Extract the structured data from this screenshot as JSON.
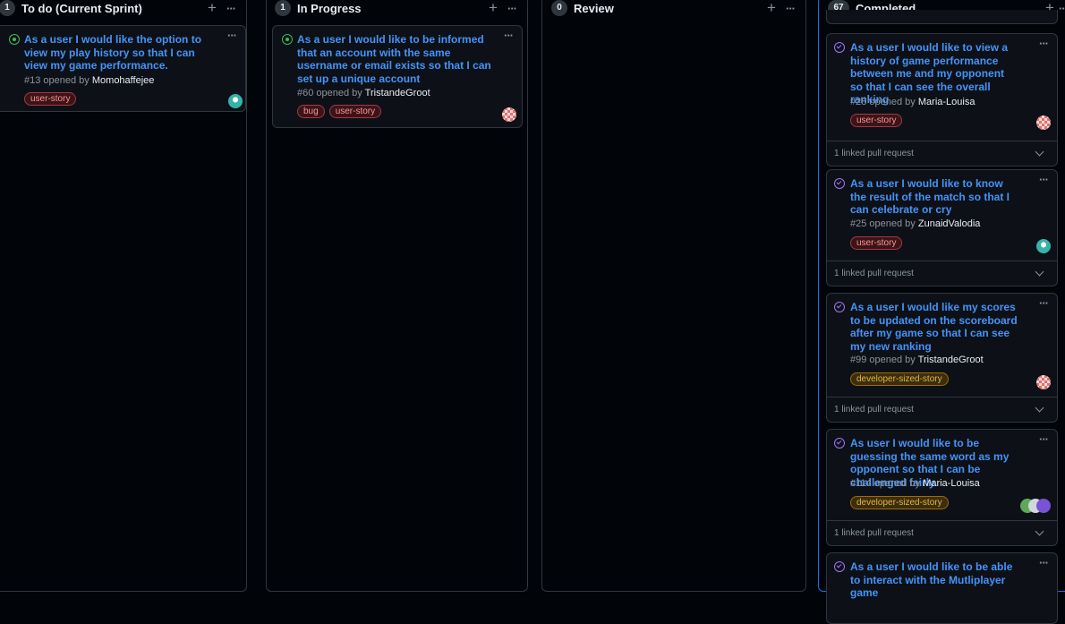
{
  "columns": {
    "todo": {
      "count": "1",
      "title": "To do (Current Sprint)"
    },
    "in_progress": {
      "count": "1",
      "title": "In Progress"
    },
    "review": {
      "count": "0",
      "title": "Review"
    },
    "completed": {
      "count": "67",
      "title": "Completed"
    }
  },
  "header_icons": {
    "add": "plus-icon",
    "menu": "kebab-horizontal-icon"
  },
  "cards": {
    "todo_0": {
      "title": "As a user I would like the option to view my play history so that I can view my game performance.",
      "number": "#13",
      "opened_by": "opened by",
      "author": "Momohaffejee",
      "labels": [
        "user-story"
      ],
      "status": "open"
    },
    "progress_0": {
      "title": "As a user I would like to be informed that an account with the same username or email exists so that I can set up a unique account",
      "number": "#60",
      "opened_by": "opened by",
      "author": "TristandeGroot",
      "labels": [
        "bug",
        "user-story"
      ],
      "status": "open"
    },
    "done_0": {
      "title": "As a user I would like to view a history of game performance between me and my opponent so that I can see the overall ranking",
      "number": "#28",
      "opened_by": "opened by",
      "author": "Maria-Louisa",
      "labels": [
        "user-story"
      ],
      "footer": "1 linked pull request",
      "status": "closed"
    },
    "done_1": {
      "title": "As a user I would like to know the result of the match so that I can celebrate or cry",
      "number": "#25",
      "opened_by": "opened by",
      "author": "ZunaidValodia",
      "labels": [
        "user-story"
      ],
      "footer": "1 linked pull request",
      "status": "closed"
    },
    "done_2": {
      "title": "As a user I would like my scores to be updated on the scoreboard after my game so that I can see my new ranking",
      "number": "#99",
      "opened_by": "opened by",
      "author": "TristandeGroot",
      "labels": [
        "developer-sized-story"
      ],
      "footer": "1 linked pull request",
      "status": "closed"
    },
    "done_3": {
      "title": "As user I would like to be guessing the same word as my opponent so that I can be challenged fairly.",
      "number": "#114",
      "opened_by": "opened by",
      "author": "Maria-Louisa",
      "labels": [
        "developer-sized-story"
      ],
      "footer": "1 linked pull request",
      "status": "closed"
    },
    "done_4": {
      "title": "As a user I would like to be able to interact with the Mutliplayer game",
      "status": "closed"
    }
  },
  "colors": {
    "accent": "#1f6feb",
    "link": "#4493f8",
    "open": "#3fb950",
    "closed": "#a371f7"
  }
}
